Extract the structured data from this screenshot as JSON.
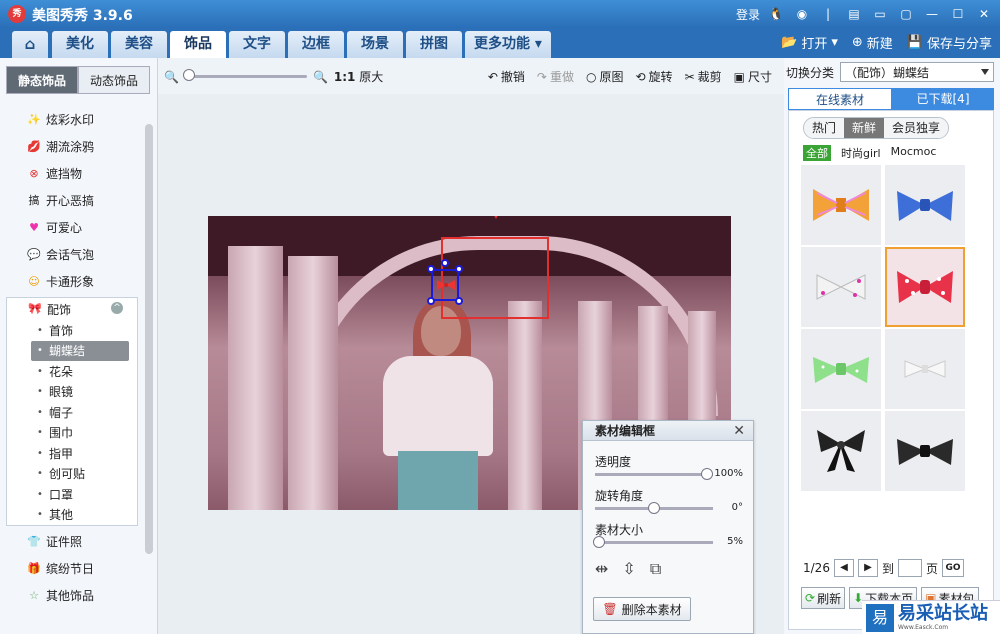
{
  "app": {
    "title": "美图秀秀 3.9.6",
    "logo_text": "秀",
    "login": "登录"
  },
  "nav": {
    "tabs": [
      "美化",
      "美容",
      "饰品",
      "文字",
      "边框",
      "场景",
      "拼图",
      "更多功能"
    ],
    "active_index": 2,
    "open": "打开",
    "new": "新建",
    "save": "保存与分享"
  },
  "sidebar": {
    "tab_static": "静态饰品",
    "tab_dynamic": "动态饰品",
    "categories_top": [
      "炫彩水印",
      "潮流涂鸦",
      "遮挡物",
      "开心恶搞",
      "可爱心",
      "会话气泡",
      "卡通形象"
    ],
    "group_title": "配饰",
    "group_items": [
      "首饰",
      "蝴蝶结",
      "花朵",
      "眼镜",
      "帽子",
      "围巾",
      "指甲",
      "创可贴",
      "口罩",
      "其他"
    ],
    "group_active_index": 1,
    "categories_bottom": [
      "证件照",
      "缤纷节日",
      "其他饰品"
    ]
  },
  "toolbar": {
    "actual_size": "1:1",
    "original_size": "原大",
    "undo": "撤销",
    "redo": "重做",
    "original": "原图",
    "rotate": "旋转",
    "crop": "裁剪",
    "resize": "尺寸"
  },
  "editor": {
    "title": "素材编辑框",
    "opacity_label": "透明度",
    "opacity_value": "100%",
    "rotate_label": "旋转角度",
    "rotate_value": "0°",
    "size_label": "素材大小",
    "size_value": "5%",
    "delete": "删除本素材"
  },
  "right": {
    "switch_label": "切换分类",
    "category": "（配饰）蝴蝶结",
    "tab_online": "在线素材",
    "tab_downloaded": "已下载[4]",
    "filters": [
      "热门",
      "新鲜",
      "会员独享"
    ],
    "filter_active_index": 1,
    "subfilters": [
      "全部",
      "时尚girl",
      "Mocmoc"
    ],
    "page": "1/26",
    "goto": "到",
    "page_unit": "页",
    "go": "GO",
    "refresh": "刷新",
    "download_page": "下载本页",
    "pack": "素材包"
  },
  "colors": {
    "accent": "#2a6fb8",
    "highlight": "#e23030",
    "selection": "#1a1ad8",
    "selected_tile": "#f0a030"
  },
  "watermark": {
    "logo": "易",
    "text": "易采站长站",
    "sub": "Www.Easck.Com"
  }
}
